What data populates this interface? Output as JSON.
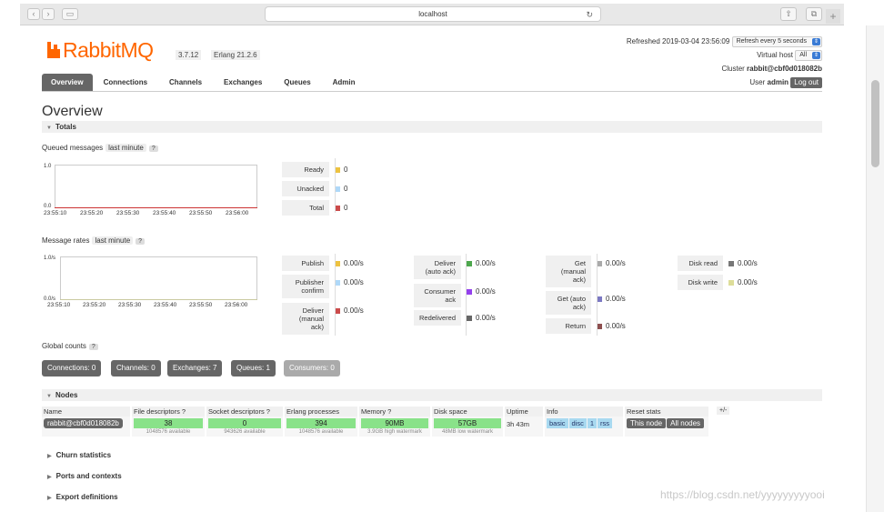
{
  "browser": {
    "url": "localhost"
  },
  "header": {
    "versions": [
      "3.7.12",
      "Erlang 21.2.6"
    ],
    "refreshed_label": "Refreshed 2019-03-04 23:56:09",
    "refresh_select": "Refresh every 5 seconds",
    "vhost_label": "Virtual host",
    "vhost_value": "All",
    "cluster_label": "Cluster",
    "cluster_value": "rabbit@cbf0d018082b",
    "user_label": "User",
    "user_value": "admin",
    "logout_label": "Log out"
  },
  "tabs": [
    "Overview",
    "Connections",
    "Channels",
    "Exchanges",
    "Queues",
    "Admin"
  ],
  "page_title": "Overview",
  "totals": {
    "heading": "Totals",
    "queued": {
      "label": "Queued messages",
      "range": "last minute",
      "help": "?",
      "y_top": "1.0",
      "y_bottom": "0.0",
      "x_ticks": [
        "23:55:10",
        "23:55:20",
        "23:55:30",
        "23:55:40",
        "23:55:50",
        "23:56:00"
      ],
      "stats": [
        {
          "name": "Ready",
          "value": "0",
          "color": "#edc240"
        },
        {
          "name": "Unacked",
          "value": "0",
          "color": "#afd8f8"
        },
        {
          "name": "Total",
          "value": "0",
          "color": "#cb4b4b"
        }
      ]
    },
    "rates": {
      "label": "Message rates",
      "range": "last minute",
      "help": "?",
      "y_top": "1.0/s",
      "y_bottom": "0.0/s",
      "x_ticks": [
        "23:55:10",
        "23:55:20",
        "23:55:30",
        "23:55:40",
        "23:55:50",
        "23:56:00"
      ],
      "col1": [
        {
          "name": "Publish",
          "value": "0.00/s",
          "color": "#edc240"
        },
        {
          "name": "Publisher confirm",
          "value": "0.00/s",
          "color": "#afd8f8"
        },
        {
          "name": "Deliver (manual ack)",
          "value": "0.00/s",
          "color": "#cb4b4b"
        }
      ],
      "col2": [
        {
          "name": "Deliver (auto ack)",
          "value": "0.00/s",
          "color": "#4da74d"
        },
        {
          "name": "Consumer ack",
          "value": "0.00/s",
          "color": "#9440ed"
        },
        {
          "name": "Redelivered",
          "value": "0.00/s",
          "color": "#666666"
        }
      ],
      "col3": [
        {
          "name": "Get (manual ack)",
          "value": "0.00/s",
          "color": "#aaaaaa"
        },
        {
          "name": "Get (auto ack)",
          "value": "0.00/s",
          "color": "#7c79c3"
        },
        {
          "name": "Return",
          "value": "0.00/s",
          "color": "#8d4f4f"
        }
      ],
      "col4": [
        {
          "name": "Disk read",
          "value": "0.00/s",
          "color": "#777777"
        },
        {
          "name": "Disk write",
          "value": "0.00/s",
          "color": "#dddd99"
        }
      ]
    },
    "global_counts": {
      "label": "Global counts",
      "help": "?",
      "buttons": [
        "Connections: 0",
        "Channels: 0",
        "Exchanges: 7",
        "Queues: 1",
        "Consumers: 0"
      ]
    }
  },
  "nodes": {
    "heading": "Nodes",
    "columns": [
      "Name",
      "File descriptors ?",
      "Socket descriptors ?",
      "Erlang processes",
      "Memory ?",
      "Disk space",
      "Uptime",
      "Info",
      "Reset stats"
    ],
    "toggle": "+/-",
    "row": {
      "name": "rabbit@cbf0d018082b",
      "fd": "38",
      "fd_sub": "1048576 available",
      "sd": "0",
      "sd_sub": "943626 available",
      "ep": "394",
      "ep_sub": "1048576 available",
      "mem": "90MB",
      "mem_sub": "3.9GB high watermark",
      "disk": "57GB",
      "disk_sub": "48MB low watermark",
      "uptime": "3h 43m",
      "info": [
        "basic",
        "disc",
        "1",
        "rss"
      ],
      "reset": [
        "This node",
        "All nodes"
      ]
    }
  },
  "collapsed": [
    "Churn statistics",
    "Ports and contexts",
    "Export definitions"
  ],
  "watermark": "https://blog.csdn.net/yyyyyyyyyooi"
}
